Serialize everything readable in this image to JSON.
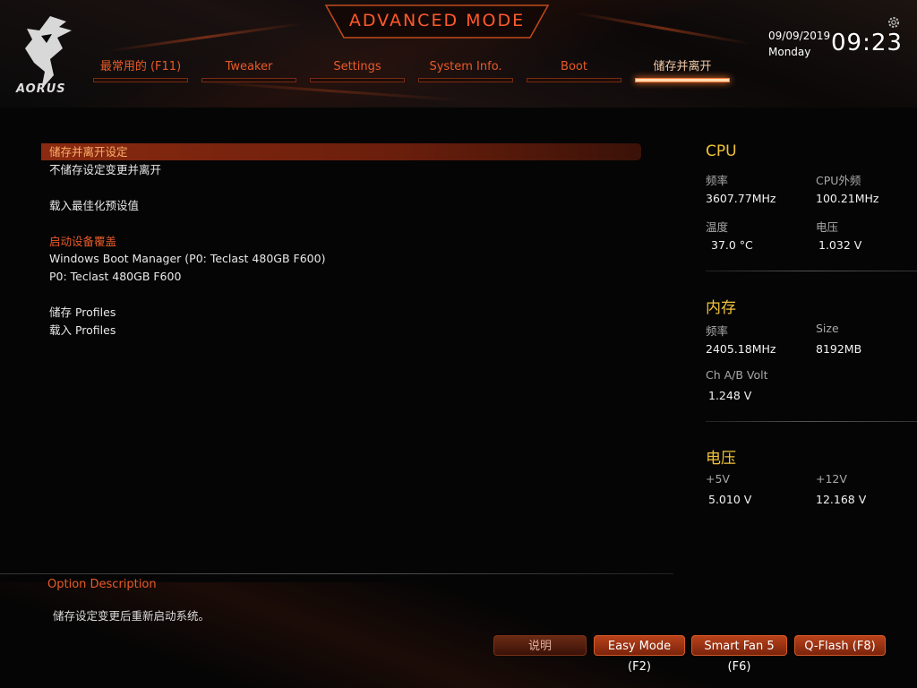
{
  "header": {
    "logo_text": "AORUS",
    "mode_title": "ADVANCED MODE",
    "tabs": [
      {
        "label": "最常用的 (F11)"
      },
      {
        "label": "Tweaker"
      },
      {
        "label": "Settings"
      },
      {
        "label": "System Info."
      },
      {
        "label": "Boot"
      },
      {
        "label": "储存并离开",
        "active": true
      }
    ],
    "date": "09/09/2019",
    "weekday": "Monday",
    "time": "09:23",
    "settings_icon": "gear-icon"
  },
  "menu": {
    "items": [
      {
        "label": "储存并离开设定",
        "selected": true
      },
      {
        "label": "不储存设定变更并离开"
      },
      {
        "label": "载入最佳化预设值"
      },
      {
        "label": "启动设备覆盖",
        "header": true
      },
      {
        "label": "Windows Boot Manager (P0: Teclast 480GB F600)"
      },
      {
        "label": "P0: Teclast 480GB F600"
      },
      {
        "label": "储存 Profiles"
      },
      {
        "label": "载入 Profiles"
      }
    ]
  },
  "panel": {
    "cpu": {
      "title": "CPU",
      "freq_label": "频率",
      "freq_value": "3607.77MHz",
      "bclk_label": "CPU外频",
      "bclk_value": "100.21MHz",
      "temp_label": "温度",
      "temp_value": "37.0 °C",
      "volt_label": "电压",
      "volt_value": "1.032 V"
    },
    "memory": {
      "title": "内存",
      "freq_label": "频率",
      "freq_value": "2405.18MHz",
      "size_label": "Size",
      "size_value": "8192MB",
      "volt_label": "Ch A/B Volt",
      "volt_value": "1.248 V"
    },
    "voltage": {
      "title": "电压",
      "v5_label": "+5V",
      "v5_value": "5.010 V",
      "v12_label": "+12V",
      "v12_value": "12.168 V"
    }
  },
  "description": {
    "title": "Option Description",
    "text": "储存设定变更后重新启动系统。"
  },
  "footer": {
    "help_label": "说明",
    "easy_mode_label": "Easy Mode (F2)",
    "smart_fan_label": "Smart Fan 5 (F6)",
    "qflash_label": "Q-Flash (F8)"
  },
  "colors": {
    "accent": "#e85a28",
    "section_title": "#f0c23a",
    "selected_row": "#8a2a10"
  }
}
